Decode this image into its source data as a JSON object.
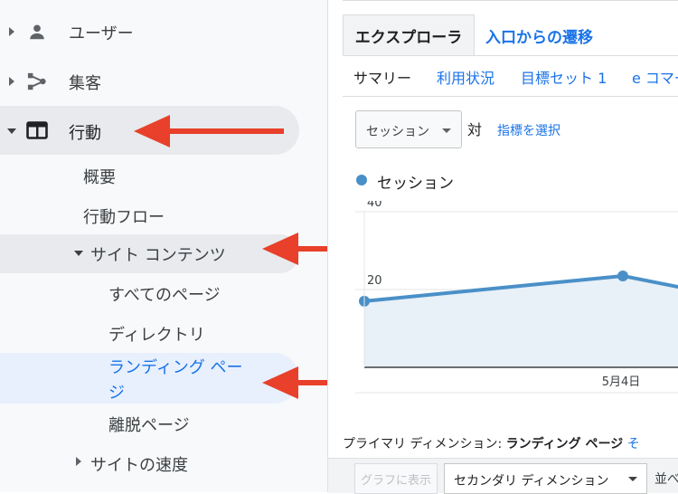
{
  "sidebar": {
    "users": "ユーザー",
    "acquisition": "集客",
    "behavior": "行動",
    "behavior_items": {
      "overview": "概要",
      "flow": "行動フロー",
      "site_content": "サイト コンテンツ",
      "all_pages": "すべてのページ",
      "directory": "ディレクトリ",
      "landing_line1": "ランディング ペー",
      "landing_line2": "ジ",
      "exit_pages": "離脱ページ",
      "site_speed": "サイトの速度"
    }
  },
  "main": {
    "tabs": [
      "エクスプローラ",
      "入口からの遷移"
    ],
    "subtabs": [
      "サマリー",
      "利用状況",
      "目標セット 1",
      "e コマー"
    ],
    "metric_select": "セッション",
    "vs_label": "対",
    "pick_metric": "指標を選択",
    "legend": "セッション",
    "primary_dimension_label": "プライマリ ディメンション:",
    "primary_dimension_value": "ランディング ページ",
    "primary_dimension_other": "そ",
    "graph_button": "グラフに表示",
    "secondary_dimension": "セカンダリ ディメンション",
    "sort_label": "並べ"
  },
  "chart_data": {
    "type": "area",
    "series": [
      {
        "name": "セッション",
        "values": [
          17,
          23.5,
          20
        ]
      }
    ],
    "x": [
      "",
      "5月4日",
      ""
    ],
    "yticks": [
      20,
      40
    ],
    "ylim": [
      0,
      40
    ],
    "color": "#4a90c8",
    "fill": "#e8f0f8"
  },
  "colors": {
    "arrow": "#e8402a",
    "link": "#1a73e8",
    "active_bg": "#e8eaed",
    "selected_bg": "#e8f0fe"
  }
}
